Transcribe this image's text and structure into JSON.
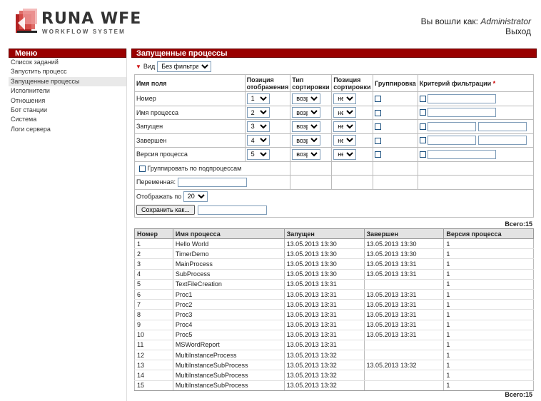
{
  "header": {
    "logo_title": "RUNA WFE",
    "logo_subtitle": "WORKFLOW SYSTEM",
    "login_prefix": "Вы вошли как:",
    "username": "Administrator",
    "logout": "Выход"
  },
  "sidebar": {
    "title": "Меню",
    "items": [
      {
        "label": "Список заданий"
      },
      {
        "label": "Запустить процесс"
      },
      {
        "label": "Запущенные процессы"
      },
      {
        "label": "Исполнители"
      },
      {
        "label": "Отношения"
      },
      {
        "label": "Бот станции"
      },
      {
        "label": "Система"
      },
      {
        "label": "Логи сервера"
      }
    ]
  },
  "main": {
    "title": "Запущенные процессы",
    "view_label": "Вид",
    "view_value": "Без фильтра"
  },
  "filter": {
    "headers": {
      "field": "Имя поля",
      "position": "Позиция отображения",
      "sort_type": "Тип сортировки",
      "sort_position": "Позиция сортировки",
      "grouping": "Группировка",
      "criteria": "Критерий фильтрации",
      "criteria_required_mark": "*"
    },
    "rows": [
      {
        "name": "Номер",
        "position": "1",
        "sort_type": "возр",
        "sort_position": "нет"
      },
      {
        "name": "Имя процесса",
        "position": "2",
        "sort_type": "возр",
        "sort_position": "нет"
      },
      {
        "name": "Запущен",
        "position": "3",
        "sort_type": "возр",
        "sort_position": "нет"
      },
      {
        "name": "Завершен",
        "position": "4",
        "sort_type": "возр",
        "sort_position": "нет"
      },
      {
        "name": "Версия процесса",
        "position": "5",
        "sort_type": "возр",
        "sort_position": "нет"
      }
    ],
    "group_by_subprocess": "Группировать по подпроцессам",
    "variable_label": "Переменная:",
    "page_size_label": "Отображать по",
    "page_size_value": "20",
    "save_as": "Сохранить как..."
  },
  "totals": {
    "top": "Всего:15",
    "bottom": "Всего:15"
  },
  "results": {
    "columns": [
      "Номер",
      "Имя процесса",
      "Запущен",
      "Завершен",
      "Версия процесса"
    ],
    "rows": [
      [
        "1",
        "Hello World",
        "13.05.2013 13:30",
        "13.05.2013 13:30",
        "1"
      ],
      [
        "2",
        "TimerDemo",
        "13.05.2013 13:30",
        "13.05.2013 13:30",
        "1"
      ],
      [
        "3",
        "MainProcess",
        "13.05.2013 13:30",
        "13.05.2013 13:31",
        "1"
      ],
      [
        "4",
        "SubProcess",
        "13.05.2013 13:30",
        "13.05.2013 13:31",
        "1"
      ],
      [
        "5",
        "TextFileCreation",
        "13.05.2013 13:31",
        "",
        "1"
      ],
      [
        "6",
        "Proc1",
        "13.05.2013 13:31",
        "13.05.2013 13:31",
        "1"
      ],
      [
        "7",
        "Proc2",
        "13.05.2013 13:31",
        "13.05.2013 13:31",
        "1"
      ],
      [
        "8",
        "Proc3",
        "13.05.2013 13:31",
        "13.05.2013 13:31",
        "1"
      ],
      [
        "9",
        "Proc4",
        "13.05.2013 13:31",
        "13.05.2013 13:31",
        "1"
      ],
      [
        "10",
        "Proc5",
        "13.05.2013 13:31",
        "13.05.2013 13:31",
        "1"
      ],
      [
        "11",
        "MSWordReport",
        "13.05.2013 13:31",
        "",
        "1"
      ],
      [
        "12",
        "MultiInstanceProcess",
        "13.05.2013 13:32",
        "",
        "1"
      ],
      [
        "13",
        "MultiInstanceSubProcess",
        "13.05.2013 13:32",
        "13.05.2013 13:32",
        "1"
      ],
      [
        "14",
        "MultiInstanceSubProcess",
        "13.05.2013 13:32",
        "",
        "1"
      ],
      [
        "15",
        "MultiInstanceSubProcess",
        "13.05.2013 13:32",
        "",
        "1"
      ]
    ]
  },
  "colors": {
    "brand_red": "#990000",
    "accent_red": "#cc0000"
  }
}
